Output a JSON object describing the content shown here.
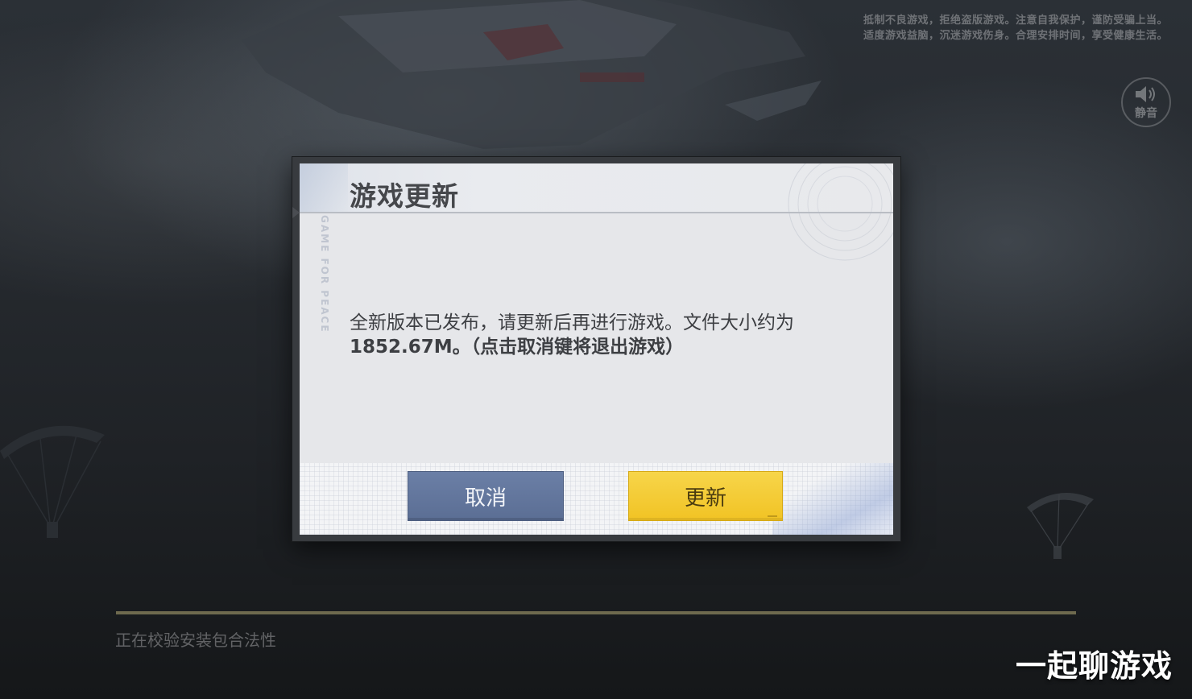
{
  "notice": {
    "line1": "抵制不良游戏，拒绝盗版游戏。注意自我保护，谨防受骗上当。",
    "line2": "适度游戏益脑，沉迷游戏伤身。合理安排时间，享受健康生活。"
  },
  "mute": {
    "icon": "speaker-icon",
    "label": "静音"
  },
  "dialog": {
    "title": "游戏更新",
    "side_watermark": "GAME FOR PEACE",
    "message_line1": "全新版本已发布，请更新后再进行游戏。文件大小约为",
    "message_line2": "1852.67M。（点击取消键将退出游戏）",
    "cancel_label": "取消",
    "update_label": "更新"
  },
  "status": {
    "text": "正在校验安装包合法性",
    "progress": 1.0
  },
  "channel_watermark": "一起聊游戏",
  "colors": {
    "cancel_button": "#5f7298",
    "update_button": "#f3c72e",
    "dialog_bg": "#e6e7ea",
    "progress_fill": "#6e6a4e"
  }
}
